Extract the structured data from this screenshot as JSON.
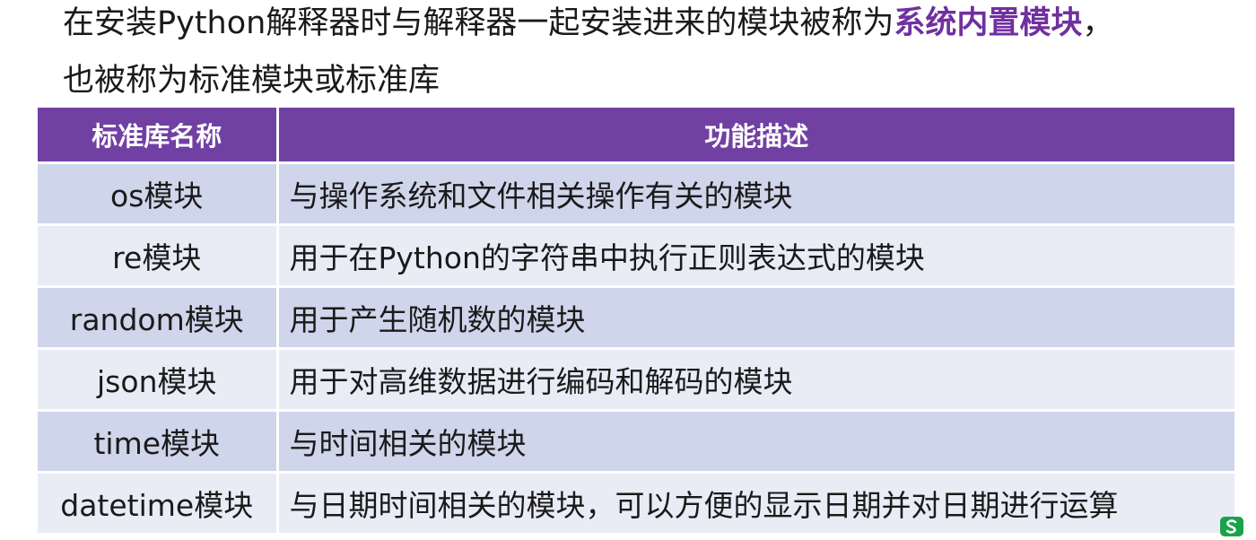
{
  "intro": {
    "line1_before": "在安装Python解释器时与解释器一起安装进来的模块被称为",
    "line1_highlight": "系统内置模块",
    "line1_after": "，",
    "line2": "也被称为标准模块或标准库"
  },
  "table": {
    "headers": {
      "name": "标准库名称",
      "desc": "功能描述"
    },
    "rows": [
      {
        "name": "os模块",
        "desc": "与操作系统和文件相关操作有关的模块"
      },
      {
        "name": "re模块",
        "desc": "用于在Python的字符串中执行正则表达式的模块"
      },
      {
        "name": "random模块",
        "desc": "用于产生随机数的模块"
      },
      {
        "name": "json模块",
        "desc": "用于对高维数据进行编码和解码的模块"
      },
      {
        "name": "time模块",
        "desc": "与时间相关的模块"
      },
      {
        "name": "datetime模块",
        "desc": "与日期时间相关的模块，可以方便的显示日期并对日期进行运算"
      }
    ]
  },
  "colors": {
    "header_bg": "#7140a3",
    "highlight": "#7030a0",
    "row_odd": "#cfd5ea",
    "row_even": "#e9ebf5"
  },
  "icons": {
    "corner": "s-logo-icon"
  }
}
